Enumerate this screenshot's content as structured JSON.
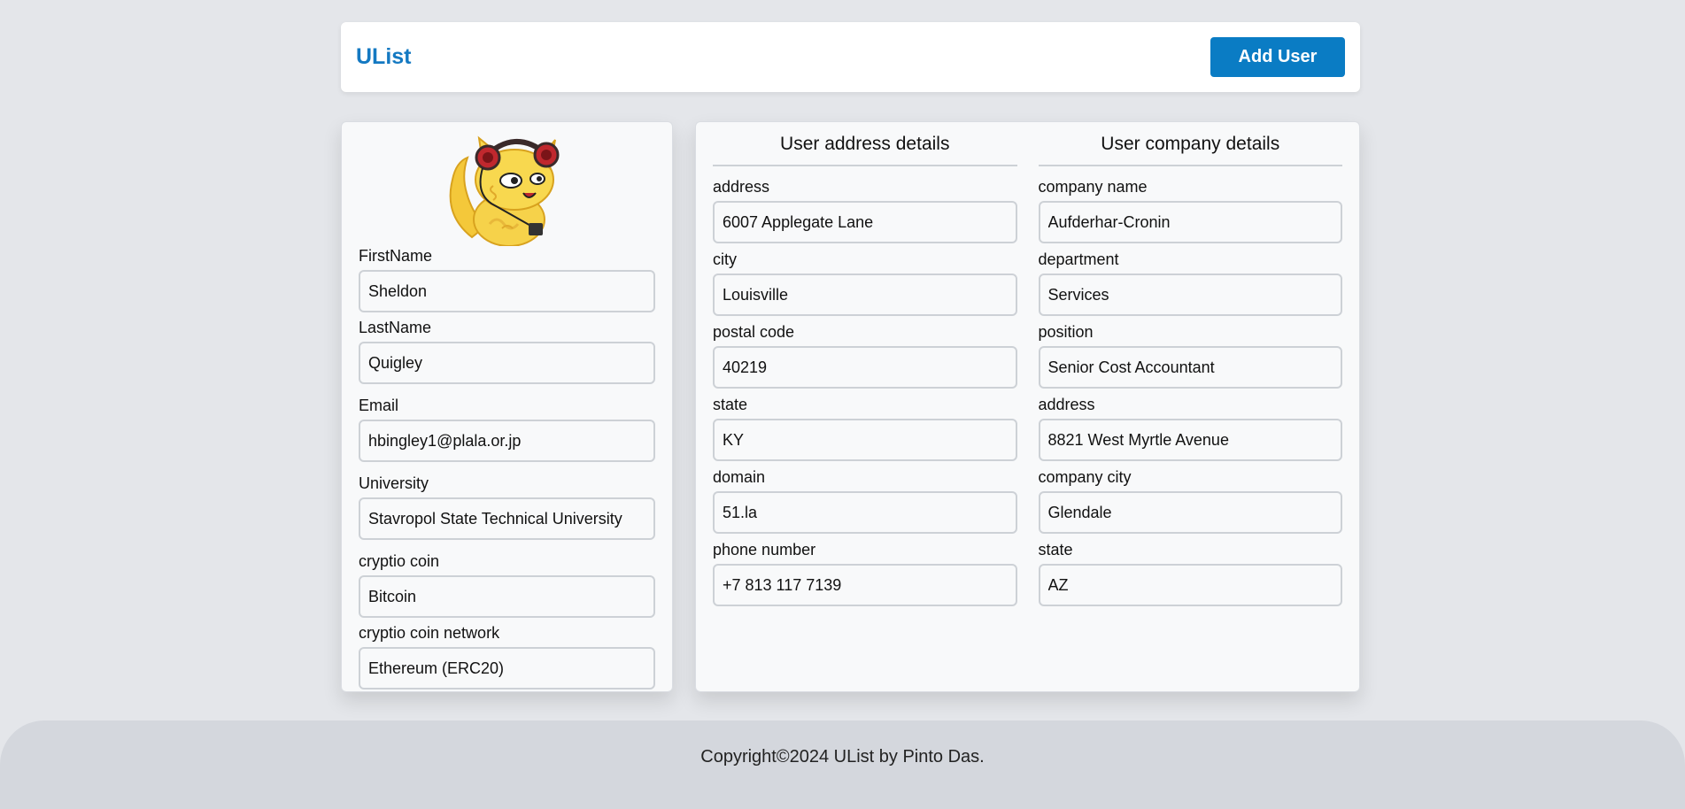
{
  "header": {
    "brand": "UList",
    "add_user_label": "Add User"
  },
  "profile": {
    "avatar_icon": "cat-with-headphones-icon",
    "fields": [
      {
        "label": "FirstName",
        "value": "Sheldon"
      },
      {
        "label": "LastName",
        "value": "Quigley"
      },
      {
        "label": "Email",
        "value": "hbingley1@plala.or.jp"
      },
      {
        "label": "University",
        "value": "Stavropol State Technical University"
      },
      {
        "label": "cryptio coin",
        "value": "Bitcoin"
      },
      {
        "label": "cryptio coin network",
        "value": "Ethereum (ERC20)"
      }
    ]
  },
  "address": {
    "title": "User address details",
    "fields": [
      {
        "label": "address",
        "value": "6007 Applegate Lane"
      },
      {
        "label": "city",
        "value": "Louisville"
      },
      {
        "label": "postal code",
        "value": "40219"
      },
      {
        "label": "state",
        "value": "KY"
      },
      {
        "label": "domain",
        "value": "51.la"
      },
      {
        "label": "phone number",
        "value": "+7 813 117 7139"
      }
    ]
  },
  "company": {
    "title": "User company details",
    "fields": [
      {
        "label": "company name",
        "value": "Aufderhar-Cronin"
      },
      {
        "label": "department",
        "value": "Services"
      },
      {
        "label": "position",
        "value": "Senior Cost Accountant"
      },
      {
        "label": "address",
        "value": "8821 West Myrtle Avenue"
      },
      {
        "label": "company city",
        "value": "Glendale"
      },
      {
        "label": "state",
        "value": "AZ"
      }
    ]
  },
  "footer": {
    "copyright": "Copyright©2024 UList by Pinto Das."
  },
  "colors": {
    "accent": "#0a7cc4",
    "brand": "#1479c2",
    "background": "#e4e6ea",
    "footer": "#d4d7dd"
  }
}
